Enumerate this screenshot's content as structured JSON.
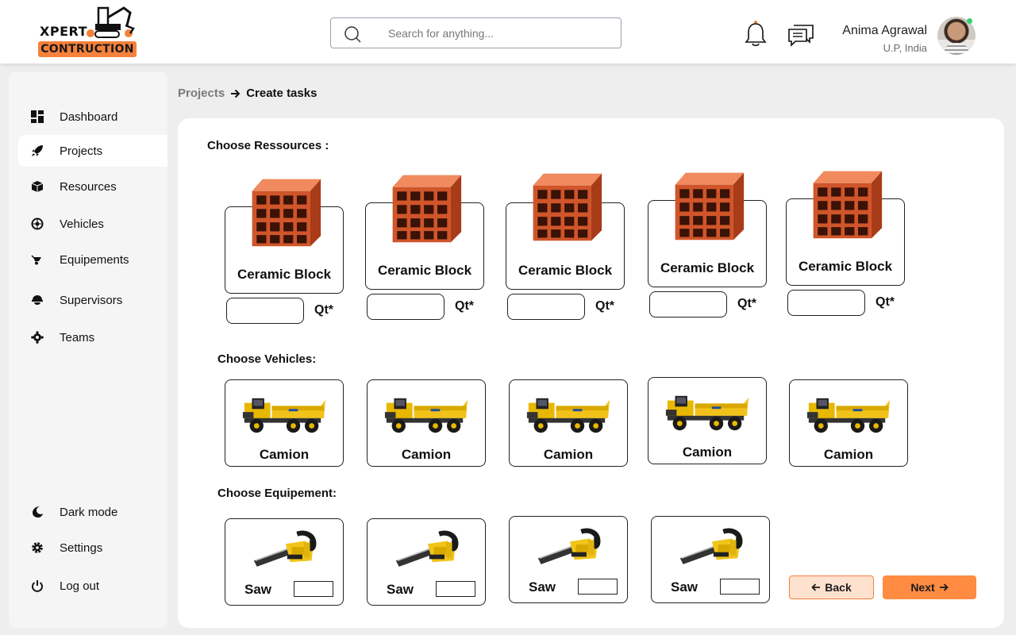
{
  "brand": {
    "name": "XPERT",
    "badge": "CONTRUCTION",
    "accent": "#f5813a"
  },
  "search": {
    "placeholder": "Search for anything..."
  },
  "user": {
    "name": "Anima Agrawal",
    "location": "U.P, India"
  },
  "sidebar": {
    "items": [
      {
        "label": "Dashboard",
        "icon": "dashboard-icon"
      },
      {
        "label": "Projects",
        "icon": "rocket-icon",
        "active": true
      },
      {
        "label": "Resources",
        "icon": "box-icon"
      },
      {
        "label": "Vehicles",
        "icon": "wheel-icon"
      },
      {
        "label": "Equipements",
        "icon": "wheelbarrow-icon"
      },
      {
        "label": "Supervisors",
        "icon": "helmet-icon"
      },
      {
        "label": "Teams",
        "icon": "team-icon"
      }
    ],
    "bottom": [
      {
        "label": "Dark mode",
        "icon": "moon-icon"
      },
      {
        "label": "Settings",
        "icon": "gear-icon"
      },
      {
        "label": "Log out",
        "icon": "power-icon"
      }
    ]
  },
  "breadcrumb": {
    "parent": "Projects",
    "current": "Create tasks"
  },
  "resources": {
    "title": "Choose Ressources :",
    "qty_label": "Qt*",
    "items": [
      "Ceramic Block",
      "Ceramic Block",
      "Ceramic Block",
      "Ceramic Block",
      "Ceramic Block"
    ]
  },
  "vehicles": {
    "title": "Choose Vehicles:",
    "items": [
      "Camion",
      "Camion",
      "Camion",
      "Camion",
      "Camion"
    ]
  },
  "equipment": {
    "title": "Choose Equipement:",
    "items": [
      "Saw",
      "Saw",
      "Saw",
      "Saw"
    ]
  },
  "actions": {
    "back": "Back",
    "next": "Next"
  }
}
